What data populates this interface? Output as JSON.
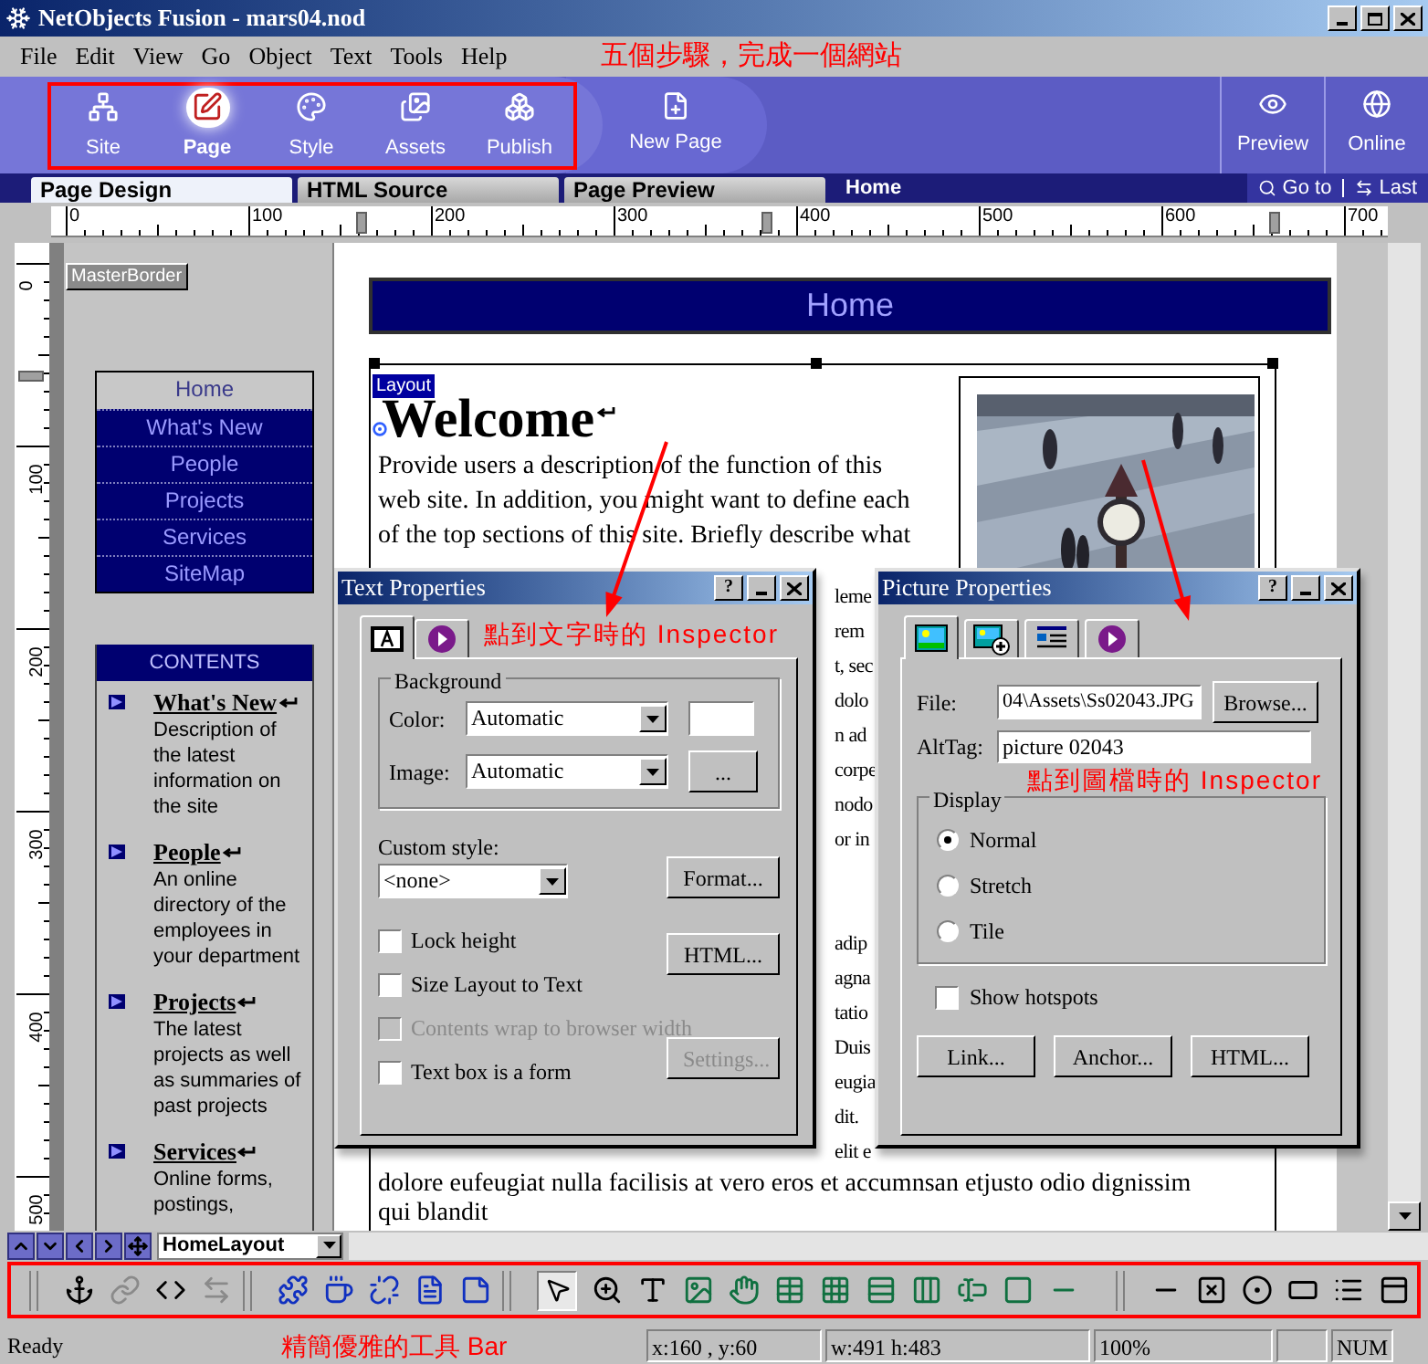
{
  "window": {
    "title": "NetObjects Fusion - mars04.nod"
  },
  "menu": [
    "File",
    "Edit",
    "View",
    "Go",
    "Object",
    "Text",
    "Tools",
    "Help"
  ],
  "menu_annotation": "五個步驟，完成一個網站",
  "views": [
    {
      "label": "Site",
      "selected": false
    },
    {
      "label": "Page",
      "selected": true
    },
    {
      "label": "Style",
      "selected": false
    },
    {
      "label": "Assets",
      "selected": false
    },
    {
      "label": "Publish",
      "selected": false
    }
  ],
  "new_page": "New Page",
  "right_views": [
    "Preview",
    "Online"
  ],
  "view_tabs": [
    {
      "label": "Page Design",
      "selected": true
    },
    {
      "label": "HTML Source",
      "selected": false
    },
    {
      "label": "Page Preview",
      "selected": false
    }
  ],
  "page_name": "Home",
  "nav_buttons": [
    "Go to",
    "Last"
  ],
  "ruler": {
    "horizontal": [
      "0",
      "100",
      "200",
      "300",
      "400",
      "500",
      "600",
      "700"
    ],
    "vertical": [
      "0",
      "100",
      "200",
      "300",
      "400",
      "500"
    ]
  },
  "canvas": {
    "master_border": "MasterBorder",
    "nav": [
      {
        "label": "Home",
        "selected": true
      },
      {
        "label": "What's New",
        "selected": false
      },
      {
        "label": "People",
        "selected": false
      },
      {
        "label": "Projects",
        "selected": false
      },
      {
        "label": "Services",
        "selected": false
      },
      {
        "label": "SiteMap",
        "selected": false
      }
    ],
    "contents": {
      "title": "CONTENTS",
      "items": [
        {
          "title": "What's New",
          "desc": "Description of the latest information on the site"
        },
        {
          "title": "People",
          "desc": "An online directory of the employees in your department"
        },
        {
          "title": "Projects",
          "desc": "The latest projects as well as summaries of past projects"
        },
        {
          "title": "Services",
          "desc": "Online forms, postings,"
        }
      ]
    },
    "banner": "Home",
    "layout_tag": "Layout",
    "heading": "Welcome",
    "lines": [
      "Provide users a description of the function of this",
      "web site. In addition, you might want to define each",
      "of the top sections of this site. Briefly describe what"
    ],
    "fragments": [
      [
        "leme",
        "rem",
        "t, sec",
        "dolo",
        "n ad",
        "corpe",
        "nodo",
        "or in"
      ],
      [
        "adip",
        "agna",
        "tatio",
        "Duis",
        "eugia",
        "dit.",
        "elit e"
      ]
    ],
    "bottom_lines": [
      "dolore eufeugiat nulla facilisis at vero eros et accumnsan etjusto odio dignissim",
      "qui blandit"
    ]
  },
  "text_properties": {
    "title": "Text Properties",
    "help_button": "?",
    "tabs": [
      {
        "selected": true
      },
      {
        "selected": false
      }
    ],
    "annotation": "點到文字時的 Inspector",
    "background": {
      "legend": "Background",
      "color_label": "Color:",
      "color_value": "Automatic",
      "image_label": "Image:",
      "image_value": "Automatic",
      "image_button": "..."
    },
    "custom_style": {
      "label": "Custom style:",
      "value": "<none>"
    },
    "format_button": "Format...",
    "checkboxes": [
      {
        "label": "Lock height",
        "checked": false,
        "disabled": false
      },
      {
        "label": "Size Layout to Text",
        "checked": false,
        "disabled": false
      },
      {
        "label": "Contents wrap to browser width",
        "checked": false,
        "disabled": true
      },
      {
        "label": "Text box is a form",
        "checked": false,
        "disabled": false
      }
    ],
    "html_button": "HTML...",
    "settings_button": {
      "label": "Settings...",
      "disabled": true
    }
  },
  "picture_properties": {
    "title": "Picture Properties",
    "help_button": "?",
    "tabs": [
      {
        "selected": true
      },
      {
        "selected": false
      },
      {
        "selected": false
      },
      {
        "selected": false
      }
    ],
    "file_label": "File:",
    "file_value": "04\\Assets\\Ss02043.JPG",
    "browse_button": "Browse...",
    "alt_label": "AltTag:",
    "alt_value": "picture 02043",
    "annotation": "點到圖檔時的 Inspector",
    "display": {
      "legend": "Display",
      "options": [
        {
          "label": "Normal",
          "selected": true
        },
        {
          "label": "Stretch",
          "selected": false
        },
        {
          "label": "Tile",
          "selected": false
        }
      ]
    },
    "hotspots": {
      "label": "Show hotspots",
      "checked": false
    },
    "buttons": [
      "Link...",
      "Anchor...",
      "HTML..."
    ]
  },
  "layout_selector": "HomeLayout",
  "toolbar_annotation": "精簡優雅的工具 Bar",
  "status_bar": [
    "Ready",
    "x:160 , y:60",
    "w:491 h:483",
    "100%",
    "NUM"
  ]
}
